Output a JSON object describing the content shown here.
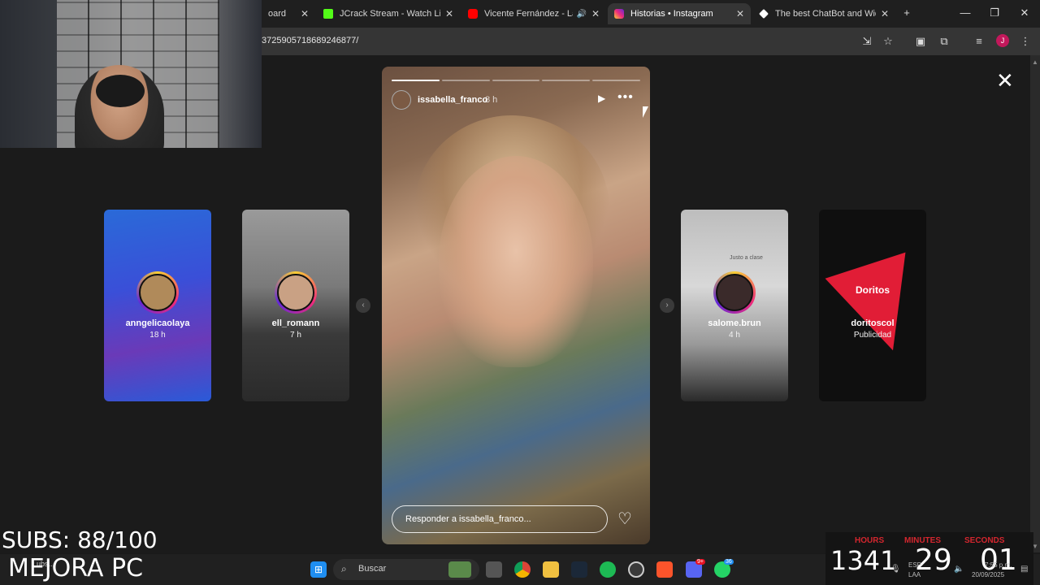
{
  "browser": {
    "tabs": [
      {
        "title": "oard",
        "favicon_color": "#1f1f1f",
        "active": false
      },
      {
        "title": "JCrack Stream - Watch Live o",
        "favicon_color": "#53fc18",
        "active": false
      },
      {
        "title": "Vicente Fernández - La R",
        "favicon_color": "#ff0000",
        "active": false,
        "audio_icon": "speaker-icon"
      },
      {
        "title": "Historias • Instagram",
        "favicon_color": "#dd2a7b",
        "active": true
      },
      {
        "title": "The best ChatBot and Widge",
        "favicon_color": "#ffffff",
        "active": false
      }
    ],
    "tab_close": "✕",
    "new_tab": "+",
    "url": "3725905718689246877/",
    "profile_initial": "J"
  },
  "viewer": {
    "close": "✕",
    "prev_arrow": "‹",
    "next_arrow": "›",
    "left_cards": [
      {
        "username": "anngelicaolaya",
        "meta": "18 h",
        "bg": "#3a4fd8"
      },
      {
        "username": "ell_romann",
        "meta": "7 h",
        "bg": "#8a8a8a"
      }
    ],
    "right_cards": [
      {
        "username": "salome.brun",
        "meta": "4 h",
        "bg": "#c8c8c8",
        "overlay_text": "Justo a clase"
      },
      {
        "username": "doritoscol",
        "meta": "Publicidad",
        "bg": "#0f0f0f",
        "logo_text": "Doritos"
      }
    ],
    "main_story": {
      "username": "issabella_franco",
      "time": "8 h",
      "progress_segments": 5,
      "progress_done": 1,
      "play": "▶",
      "more": "•••",
      "reply_placeholder": "Responder a issabella_franco...",
      "like": "♡"
    }
  },
  "overlays": {
    "subs": "SUBS: 88/100",
    "mejora": "MEJORA PC",
    "taskbar_small": "Lubs...",
    "timer": {
      "hours_label": "HOURS",
      "minutes_label": "MINUTES",
      "seconds_label": "SECONDS",
      "hours": "1341",
      "minutes": "29",
      "seconds": "01",
      "lang_a": "ESP",
      "lang_b": "LAA",
      "clock_time": "7:55 p.m.",
      "date": "20/09/2025"
    }
  },
  "taskbar": {
    "search_label": "Buscar",
    "apps": [
      "windows-start-icon",
      "search-icon",
      "weather-widget-icon",
      "task-view-icon",
      "chrome-icon",
      "file-explorer-icon",
      "steam-icon",
      "spotify-icon",
      "obs-icon",
      "brave-icon",
      "discord-icon",
      "whatsapp-icon"
    ],
    "discord_badge": "9+",
    "whatsapp_badge": "36"
  }
}
